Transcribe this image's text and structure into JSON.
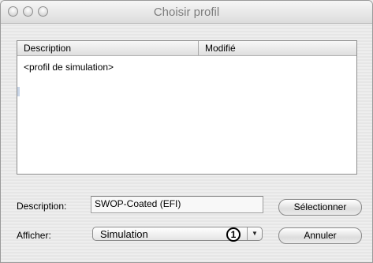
{
  "window": {
    "title": "Choisir profil"
  },
  "table": {
    "columns": [
      "Description",
      "Modifié"
    ],
    "rows": [
      {
        "description": "<profil de simulation>",
        "modified": ""
      }
    ]
  },
  "description_field": {
    "label": "Description:",
    "value": "SWOP-Coated (EFI)"
  },
  "afficher": {
    "label": "Afficher:",
    "selected": "Simulation",
    "callout": "1"
  },
  "buttons": {
    "select": "Sélectionner",
    "cancel": "Annuler"
  }
}
